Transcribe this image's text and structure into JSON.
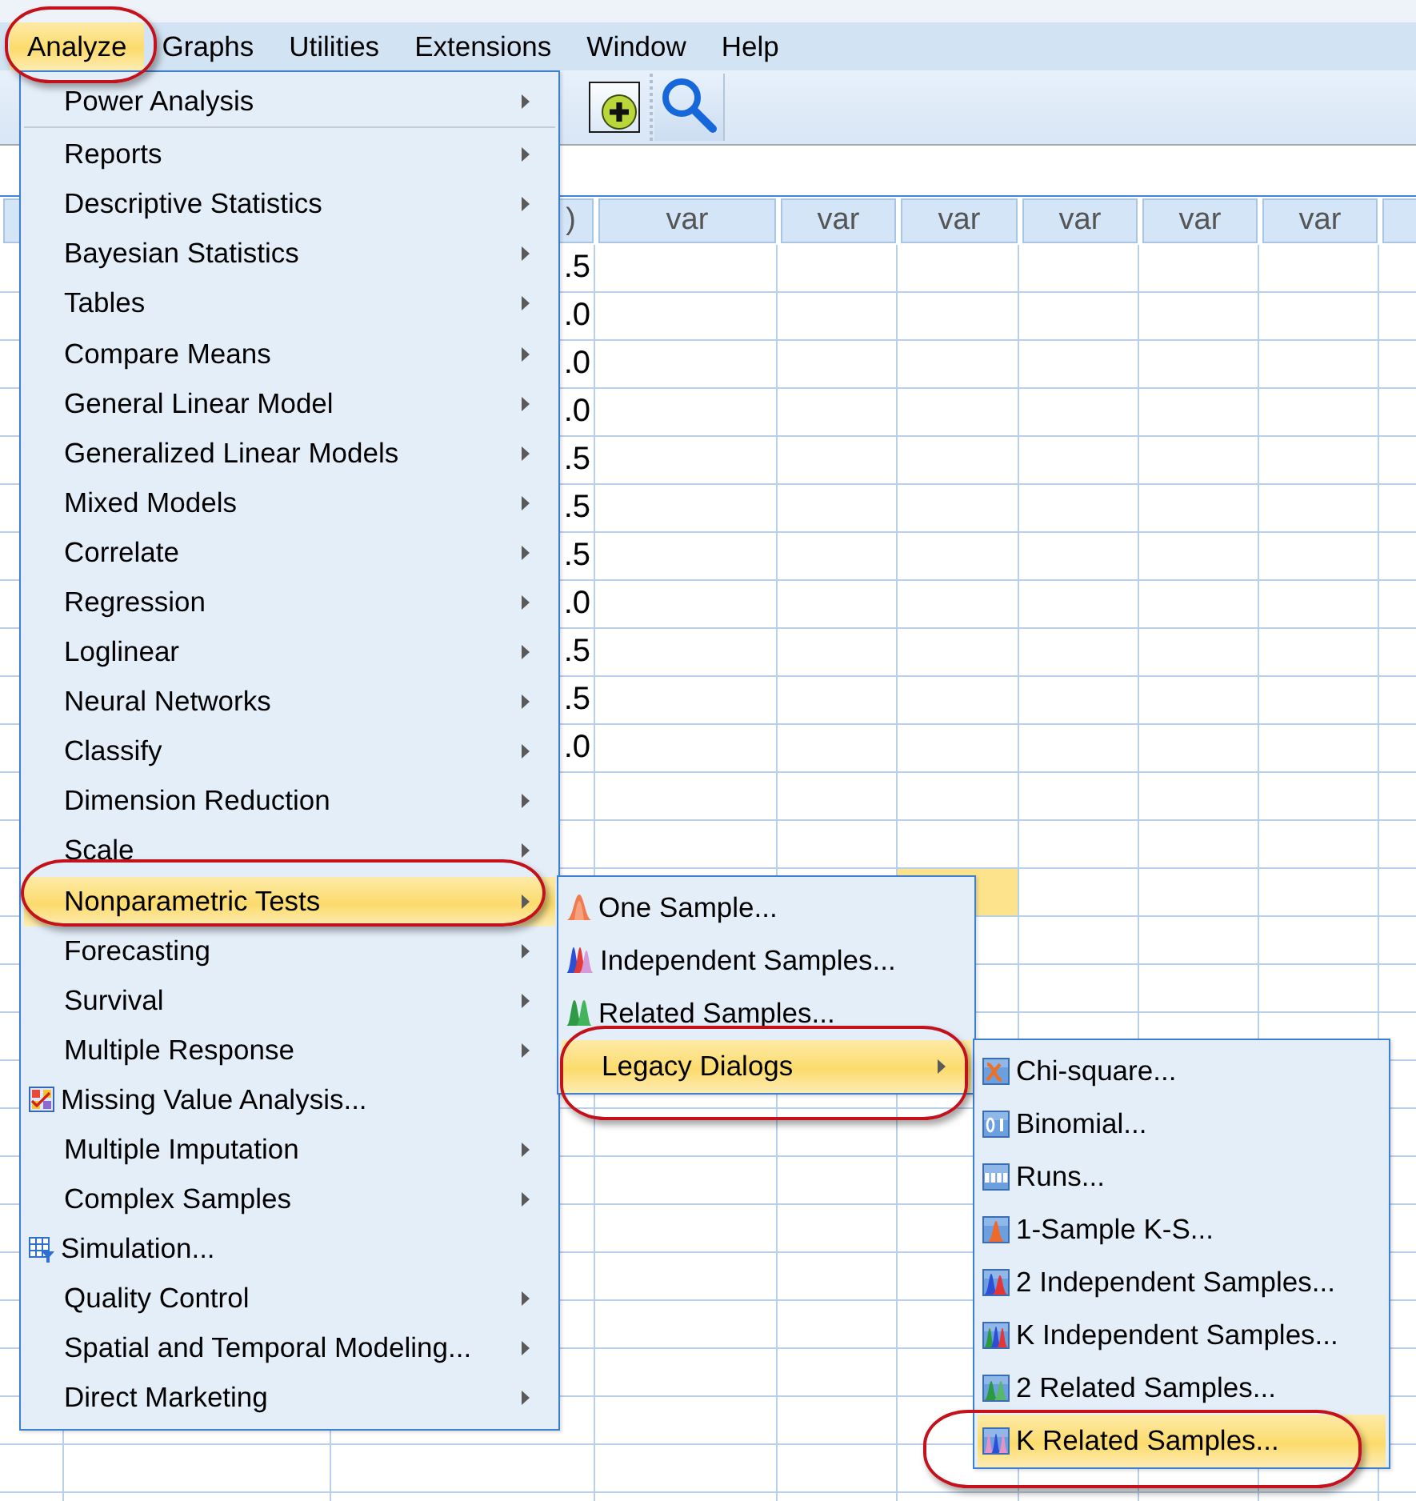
{
  "menubar": [
    {
      "label": "Analyze",
      "selected": true,
      "circled": true
    },
    {
      "label": "Graphs",
      "selected": false,
      "circled": false
    },
    {
      "label": "Utilities",
      "selected": false,
      "circled": false
    },
    {
      "label": "Extensions",
      "selected": false,
      "circled": false
    },
    {
      "label": "Window",
      "selected": false,
      "circled": false
    },
    {
      "label": "Help",
      "selected": false,
      "circled": false
    }
  ],
  "grid": {
    "columns": [
      {
        "label": ")",
        "selected": false
      },
      {
        "label": "var",
        "selected": false
      },
      {
        "label": "var",
        "selected": false
      },
      {
        "label": "var",
        "selected": true
      },
      {
        "label": "var",
        "selected": false
      },
      {
        "label": "var",
        "selected": false
      },
      {
        "label": "var",
        "selected": false
      }
    ],
    "rows": [
      {
        "value": ".5",
        "selected": false
      },
      {
        "value": ".0",
        "selected": false
      },
      {
        "value": ".0",
        "selected": false
      },
      {
        "value": ".0",
        "selected": false
      },
      {
        "value": ".5",
        "selected": false
      },
      {
        "value": ".5",
        "selected": false
      },
      {
        "value": ".5",
        "selected": false
      },
      {
        "value": ".0",
        "selected": false
      },
      {
        "value": ".5",
        "selected": false
      },
      {
        "value": ".5",
        "selected": false
      },
      {
        "value": ".0",
        "selected": false
      },
      {
        "selected": false
      },
      {
        "selected": false
      },
      {
        "selected": true
      }
    ]
  },
  "open_menus": [
    {
      "items": [
        {
          "label": "Power Analysis",
          "kind": "submenu",
          "selected": false,
          "circled": false
        },
        {
          "kind": "separator"
        },
        {
          "label": "Reports",
          "kind": "submenu",
          "selected": false,
          "circled": false
        },
        {
          "label": "Descriptive Statistics",
          "kind": "submenu",
          "selected": false,
          "circled": false
        },
        {
          "label": "Bayesian Statistics",
          "kind": "submenu",
          "selected": false,
          "circled": false
        },
        {
          "label": "Tables",
          "kind": "submenu",
          "selected": false,
          "circled": false
        },
        {
          "label": "Compare Means",
          "kind": "submenu",
          "selected": false,
          "circled": false
        },
        {
          "label": "General Linear Model",
          "kind": "submenu",
          "selected": false,
          "circled": false
        },
        {
          "label": "Generalized Linear Models",
          "kind": "submenu",
          "selected": false,
          "circled": false
        },
        {
          "label": "Mixed Models",
          "kind": "submenu",
          "selected": false,
          "circled": false
        },
        {
          "label": "Correlate",
          "kind": "submenu",
          "selected": false,
          "circled": false
        },
        {
          "label": "Regression",
          "kind": "submenu",
          "selected": false,
          "circled": false
        },
        {
          "label": "Loglinear",
          "kind": "submenu",
          "selected": false,
          "circled": false
        },
        {
          "label": "Neural Networks",
          "kind": "submenu",
          "selected": false,
          "circled": false
        },
        {
          "label": "Classify",
          "kind": "submenu",
          "selected": false,
          "circled": false
        },
        {
          "label": "Dimension Reduction",
          "kind": "submenu",
          "selected": false,
          "circled": false
        },
        {
          "label": "Scale",
          "kind": "submenu",
          "selected": false,
          "circled": false
        },
        {
          "label": "Nonparametric Tests",
          "kind": "submenu",
          "selected": true,
          "circled": true
        },
        {
          "label": "Forecasting",
          "kind": "submenu",
          "selected": false,
          "circled": false
        },
        {
          "label": "Survival",
          "kind": "submenu",
          "selected": false,
          "circled": false
        },
        {
          "label": "Multiple Response",
          "kind": "submenu",
          "selected": false,
          "circled": false
        },
        {
          "label": "Missing Value Analysis...",
          "kind": "command",
          "selected": false,
          "circled": false
        },
        {
          "label": "Multiple Imputation",
          "kind": "submenu",
          "selected": false,
          "circled": false
        },
        {
          "label": "Complex Samples",
          "kind": "submenu",
          "selected": false,
          "circled": false
        },
        {
          "label": "Simulation...",
          "kind": "command",
          "selected": false,
          "circled": false
        },
        {
          "label": "Quality Control",
          "kind": "submenu",
          "selected": false,
          "circled": false
        },
        {
          "label": "Spatial and Temporal Modeling...",
          "kind": "submenu",
          "selected": false,
          "circled": false
        },
        {
          "label": "Direct Marketing",
          "kind": "submenu",
          "selected": false,
          "circled": false
        }
      ]
    },
    {
      "items": [
        {
          "label": "One Sample...",
          "kind": "command",
          "selected": false,
          "circled": false
        },
        {
          "label": "Independent Samples...",
          "kind": "command",
          "selected": false,
          "circled": false
        },
        {
          "label": "Related Samples...",
          "kind": "command",
          "selected": false,
          "circled": false
        },
        {
          "label": "Legacy Dialogs",
          "kind": "submenu",
          "selected": true,
          "circled": true
        }
      ]
    },
    {
      "items": [
        {
          "label": "Chi-square...",
          "kind": "command",
          "selected": false,
          "circled": false
        },
        {
          "label": "Binomial...",
          "kind": "command",
          "selected": false,
          "circled": false
        },
        {
          "label": "Runs...",
          "kind": "command",
          "selected": false,
          "circled": false
        },
        {
          "label": "1-Sample K-S...",
          "kind": "command",
          "selected": false,
          "circled": false
        },
        {
          "label": "2 Independent Samples...",
          "kind": "command",
          "selected": false,
          "circled": false
        },
        {
          "label": "K Independent Samples...",
          "kind": "command",
          "selected": false,
          "circled": false
        },
        {
          "label": "2 Related Samples...",
          "kind": "command",
          "selected": false,
          "circled": false
        },
        {
          "label": "K Related Samples...",
          "kind": "command",
          "selected": true,
          "circled": true
        }
      ]
    }
  ]
}
